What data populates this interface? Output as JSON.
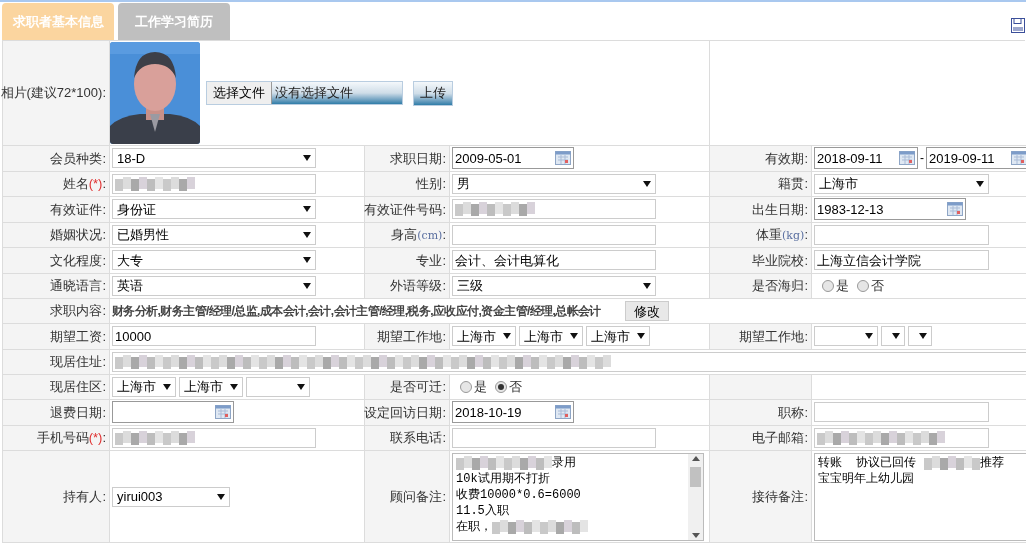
{
  "tabs": [
    {
      "label": "求职者基本信息",
      "selected": true
    },
    {
      "label": "工作学习简历",
      "selected": false
    }
  ],
  "photo_row": {
    "label": "相片(建议72*100):",
    "file_button": "选择文件",
    "file_status": "没有选择文件",
    "upload_button": "上传"
  },
  "rows": [
    {
      "kind": "triple",
      "items": [
        {
          "label": "会员种类:",
          "field": {
            "kind": "select",
            "value": "18-D"
          }
        },
        {
          "label": "求职日期:",
          "field": {
            "kind": "date",
            "value": "2009-05-01"
          }
        },
        {
          "label": "有效期:",
          "field": {
            "kind": "date-range",
            "from": "2018-09-11",
            "separator": "-",
            "to": "2019-09-11"
          }
        }
      ]
    },
    {
      "kind": "triple",
      "items": [
        {
          "label": "姓名",
          "note": "(*)",
          "required": true,
          "after": ":",
          "field": {
            "kind": "text",
            "redacted": true
          }
        },
        {
          "label": "性别:",
          "field": {
            "kind": "select",
            "value": "男"
          }
        },
        {
          "label": "籍贯:",
          "field": {
            "kind": "select",
            "value": "上海市"
          }
        }
      ]
    },
    {
      "kind": "triple",
      "items": [
        {
          "label": "有效证件:",
          "field": {
            "kind": "select",
            "value": "身份证"
          }
        },
        {
          "label": "有效证件号码:",
          "field": {
            "kind": "text",
            "redacted": true
          }
        },
        {
          "label": "出生日期:",
          "field": {
            "kind": "date",
            "value": "1983-12-13"
          }
        }
      ]
    },
    {
      "kind": "triple",
      "items": [
        {
          "label": "婚姻状况:",
          "field": {
            "kind": "select",
            "value": "已婚男性"
          }
        },
        {
          "label": "身高",
          "note": "(cm)",
          "required": false,
          "after": ":",
          "field": {
            "kind": "text"
          }
        },
        {
          "label": "体重",
          "note": "(kg)",
          "required": false,
          "after": ":",
          "field": {
            "kind": "text"
          }
        }
      ]
    },
    {
      "kind": "triple",
      "items": [
        {
          "label": "文化程度:",
          "field": {
            "kind": "select",
            "value": "大专"
          }
        },
        {
          "label": "专业:",
          "field": {
            "kind": "text",
            "value": "会计、会计电算化"
          }
        },
        {
          "label": "毕业院校:",
          "field": {
            "kind": "text",
            "value": "上海立信会计学院"
          }
        }
      ]
    },
    {
      "kind": "triple",
      "items": [
        {
          "label": "通晓语言:",
          "field": {
            "kind": "select",
            "value": "英语"
          }
        },
        {
          "label": "外语等级:",
          "field": {
            "kind": "select",
            "value": "三级"
          }
        },
        {
          "label": "是否海归:",
          "field": {
            "kind": "radio",
            "options": [
              {
                "label": "是",
                "selected": false
              },
              {
                "label": "否",
                "selected": false
              }
            ]
          }
        }
      ]
    },
    {
      "kind": "wide",
      "label": "求职内容:",
      "field": {
        "kind": "content",
        "value": "财务分析,财务主管/经理/总监,成本会计,会计,会计主管/经理,税务,应收应付,资金主管/经理,总帐会计",
        "button": "修改"
      }
    },
    {
      "kind": "triple",
      "items": [
        {
          "label": "期望工资:",
          "field": {
            "kind": "text",
            "value": "10000"
          }
        },
        {
          "label": "期望工作地:",
          "field": {
            "kind": "select-group",
            "selects": [
              {
                "kind": "wide",
                "value": "上海市"
              },
              {
                "kind": "wide",
                "value": "上海市"
              },
              {
                "kind": "wide",
                "value": "上海市"
              }
            ]
          }
        },
        {
          "label": "期望工作地:",
          "field": {
            "kind": "select-group",
            "selects": [
              {
                "kind": "wide"
              },
              {
                "kind": "narrow"
              },
              {
                "kind": "narrow"
              }
            ]
          }
        }
      ]
    },
    {
      "kind": "wide",
      "label": "现居住址:",
      "field": {
        "kind": "text",
        "redacted": true
      }
    },
    {
      "kind": "triple",
      "items": [
        {
          "label": "现居住区:",
          "field": {
            "kind": "select-group",
            "selects": [
              {
                "kind": "wide",
                "value": "上海市"
              },
              {
                "kind": "wide",
                "value": "上海市"
              },
              {
                "kind": "wide"
              }
            ]
          }
        },
        {
          "label": "是否可迁:",
          "field": {
            "kind": "radio",
            "options": [
              {
                "label": "是",
                "selected": false
              },
              {
                "label": "否",
                "selected": true
              }
            ]
          }
        },
        {
          "field": {
            "kind": "none"
          }
        }
      ]
    },
    {
      "kind": "triple",
      "items": [
        {
          "label": "退费日期:",
          "field": {
            "kind": "date"
          }
        },
        {
          "label": "设定回访日期:",
          "field": {
            "kind": "date",
            "value": "2018-10-19"
          }
        },
        {
          "label": "职称:",
          "field": {
            "kind": "text"
          }
        }
      ]
    },
    {
      "kind": "triple",
      "items": [
        {
          "label": "手机号码",
          "note": "(*)",
          "required": true,
          "after": ":",
          "field": {
            "kind": "text",
            "redacted": true
          }
        },
        {
          "label": "联系电话:",
          "field": {
            "kind": "text"
          }
        },
        {
          "label": "电子邮箱:",
          "field": {
            "kind": "text",
            "redacted": true
          }
        }
      ]
    },
    {
      "kind": "tall",
      "items": [
        {
          "label": "持有人:",
          "field": {
            "kind": "select-short",
            "value": "yirui003"
          }
        },
        {
          "label": "顾问备注:",
          "field": {
            "kind": "textarea",
            "scrollbar": true,
            "lines": [
              [
                {
                  "kind": "redacted"
                },
                {
                  "kind": "text",
                  "text": "录用"
                }
              ],
              [
                {
                  "kind": "text",
                  "text": "10k试用期不打折"
                }
              ],
              [
                {
                  "kind": "text",
                  "text": "收费10000*0.6=6000"
                }
              ],
              [
                {
                  "kind": "text",
                  "text": "11.5入职"
                }
              ],
              [
                {
                  "kind": "text",
                  "text": "在职，"
                },
                {
                  "kind": "redacted"
                }
              ]
            ]
          }
        },
        {
          "label": "接待备注:",
          "field": {
            "kind": "textarea",
            "lines": [
              [
                {
                  "kind": "text",
                  "text": "转账  协议已回传 "
                },
                {
                  "kind": "redacted"
                },
                {
                  "kind": "text",
                  "text": "推荐"
                }
              ],
              [
                {
                  "kind": "text",
                  "text": "宝宝明年上幼儿园"
                }
              ]
            ]
          }
        }
      ]
    }
  ]
}
